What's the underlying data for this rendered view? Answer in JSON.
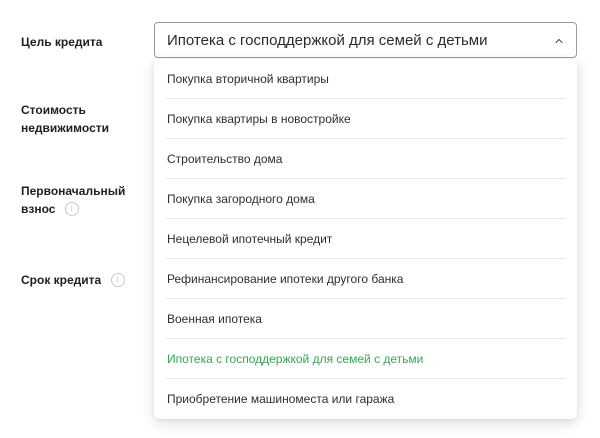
{
  "form": {
    "goal_label": "Цель кредита",
    "cost_label": "Стоимость недвижимости",
    "down_payment_label": "Первоначальный взнос",
    "term_label": "Срок кредита",
    "info_glyph": "i"
  },
  "select": {
    "value": "Ипотека с господдержкой для семей с детьми",
    "expanded": true,
    "icon": "chevron-up-icon"
  },
  "options": [
    {
      "label": "Покупка вторичной квартиры",
      "selected": false
    },
    {
      "label": "Покупка квартиры в новостройке",
      "selected": false
    },
    {
      "label": "Строительство дома",
      "selected": false
    },
    {
      "label": "Покупка загородного дома",
      "selected": false
    },
    {
      "label": "Нецелевой ипотечный кредит",
      "selected": false
    },
    {
      "label": "Рефинансирование ипотеки другого банка",
      "selected": false
    },
    {
      "label": "Военная ипотека",
      "selected": false
    },
    {
      "label": "Ипотека с господдержкой для семей с детьми",
      "selected": true
    },
    {
      "label": "Приобретение машиноместа или гаража",
      "selected": false
    }
  ],
  "colors": {
    "selected_option": "#34a853",
    "text": "#1f1f1f",
    "border": "#9a9a9a"
  }
}
